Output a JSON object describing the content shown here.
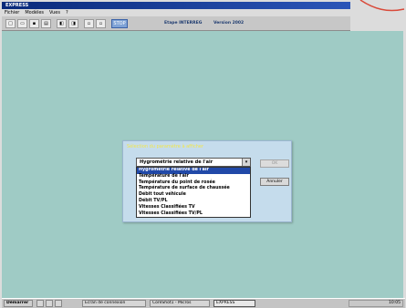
{
  "window": {
    "title": "EXPRESS"
  },
  "menu": [
    "Fichier",
    "Modèles",
    "Vues",
    "?"
  ],
  "toolbar": {
    "highlight_label": "STOP",
    "version_text": "Etape INTERREG",
    "version_num": "Version 2002"
  },
  "dialog": {
    "title": "Sélection du paramètre à afficher",
    "selected": "Hygrométrie relative de l'air",
    "options": [
      "Hygrométrie relative de l'air",
      "Température de l'air",
      "Température du point de rosée",
      "Température de surface de chaussée",
      "Débit tout véhicule",
      "Débit TV/PL",
      "Vitesses Classifiées TV",
      "Vitesses Classifiées TV/PL"
    ],
    "ok_label": "OK",
    "cancel_label": "Annuler"
  },
  "taskbar": {
    "start_label": "Démarrer",
    "items": [
      "Ecran de connexion",
      "CoreShot1 - Micros",
      "EXPRESS"
    ],
    "clock": "10:05"
  },
  "colors": {
    "workspace": "#9fcbc5",
    "dialog_bg": "#c5dcec",
    "selection": "#2149a8",
    "dialog_title": "#f2e64a"
  }
}
